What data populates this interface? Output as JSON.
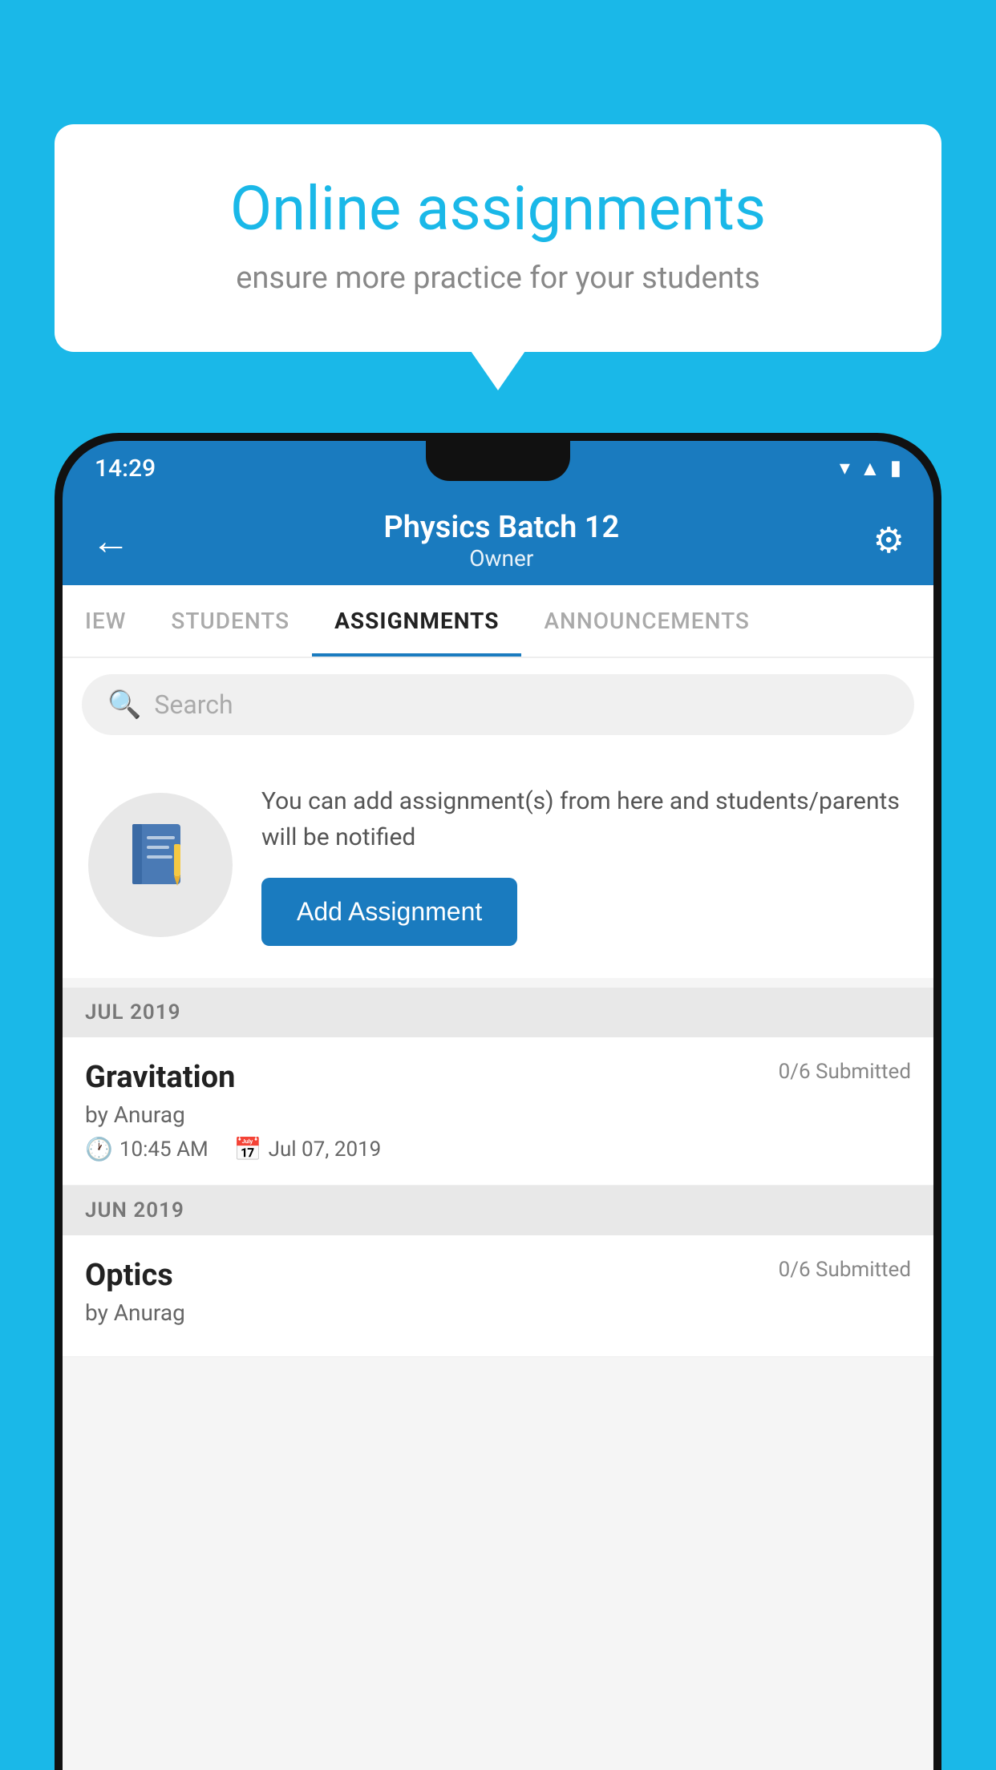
{
  "background_color": "#1ab8e8",
  "speech_bubble": {
    "title": "Online assignments",
    "subtitle": "ensure more practice for your students"
  },
  "status_bar": {
    "time": "14:29",
    "icons": [
      "wifi",
      "signal",
      "battery"
    ]
  },
  "header": {
    "title": "Physics Batch 12",
    "subtitle": "Owner"
  },
  "tabs": [
    {
      "label": "IEW",
      "active": false
    },
    {
      "label": "STUDENTS",
      "active": false
    },
    {
      "label": "ASSIGNMENTS",
      "active": true
    },
    {
      "label": "ANNOUNCEMENTS",
      "active": false
    }
  ],
  "search": {
    "placeholder": "Search"
  },
  "info_card": {
    "text": "You can add assignment(s) from here and students/parents will be notified",
    "button_label": "Add Assignment"
  },
  "sections": [
    {
      "month": "JUL 2019",
      "assignments": [
        {
          "title": "Gravitation",
          "submitted": "0/6 Submitted",
          "by": "by Anurag",
          "time": "10:45 AM",
          "date": "Jul 07, 2019"
        }
      ]
    },
    {
      "month": "JUN 2019",
      "assignments": [
        {
          "title": "Optics",
          "submitted": "0/6 Submitted",
          "by": "by Anurag",
          "time": "",
          "date": ""
        }
      ]
    }
  ],
  "icons": {
    "back": "←",
    "settings": "⚙",
    "search": "🔍",
    "clock": "🕐",
    "calendar": "📅",
    "notebook": "📓"
  }
}
